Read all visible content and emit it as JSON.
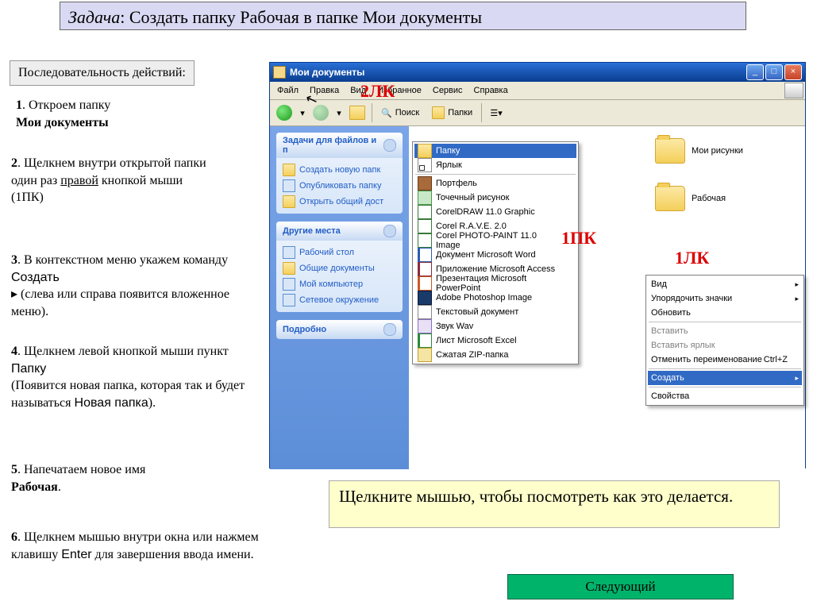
{
  "header": {
    "prefix": "Задача",
    "text": ": Создать папку Рабочая в папке Мои документы"
  },
  "seq_header": "Последовательность действий:",
  "steps": {
    "s1": {
      "n": "1",
      "t": ". Откроем папку",
      "b": "Мои документы"
    },
    "s2": {
      "n": "2",
      "t1": ". Щелкнем внутри открытой папки один раз ",
      "u": "правой",
      "t2": " кнопкой мыши (1ПК)"
    },
    "s3": {
      "n": "3",
      "t1": ". В контекстном меню укажем  команду ",
      "cmd": "Создать",
      "arrow": "▸",
      "t2": "  (слева или справа появится вложенное меню)."
    },
    "s4": {
      "n": "4",
      "t1": ". Щелкнем левой кнопкой мыши пункт ",
      "cmd": "Папку",
      "t2": "(Появится новая папка, которая так и будет называться ",
      "cmd2": "Новая папка",
      "t3": ")."
    },
    "s5": {
      "n": "5",
      "t": ". Напечатаем новое имя ",
      "b": "Рабочая",
      "dot": "."
    },
    "s6": {
      "n": "6",
      "t1": ". Щелкнем мышью внутри окна или нажмем клавишу ",
      "cmd": "Enter",
      "t2": " для завершения ввода имени."
    }
  },
  "hint": "Щелкните мышью, чтобы посмотреть как это делается.",
  "next": "Следующий",
  "annot": {
    "a1": "2ЛК",
    "a2": "1ПК",
    "a3": "1ЛК"
  },
  "win": {
    "title": "Мои документы",
    "menu": [
      "Файл",
      "Правка",
      "Вид",
      "Избранное",
      "Сервис",
      "Справка"
    ],
    "tb_search": "Поиск",
    "tb_folders": "Папки",
    "side": {
      "tasks_hd": "Задачи для файлов и п",
      "tasks": [
        "Создать новую папк",
        "Опубликовать папку",
        "Открыть общий дост"
      ],
      "places_hd": "Другие места",
      "places": [
        "Рабочий стол",
        "Общие документы",
        "Мой компьютер",
        "Сетевое окружение"
      ],
      "details_hd": "Подробно"
    },
    "folders": {
      "f1": "Мои рисунки",
      "f2": "Рабочая"
    }
  },
  "ctx1": {
    "items": [
      "Вид",
      "Упорядочить значки",
      "Обновить",
      "Вставить",
      "Вставить ярлык"
    ],
    "undo": "Отменить переименование",
    "undo_k": "Ctrl+Z",
    "create": "Создать",
    "props": "Свойства"
  },
  "ctx2": {
    "folder": "Папку",
    "link": "Ярлык",
    "items": [
      "Портфель",
      "Точечный рисунок",
      "CorelDRAW 11.0 Graphic",
      "Corel R.A.V.E. 2.0",
      "Corel PHOTO-PAINT 11.0 Image",
      "Документ Microsoft Word",
      "Приложение Microsoft Access",
      "Презентация Microsoft PowerPoint",
      "Adobe Photoshop Image",
      "Текстовый документ",
      "Звук Wav",
      "Лист Microsoft Excel",
      "Сжатая ZIP-папка"
    ]
  }
}
